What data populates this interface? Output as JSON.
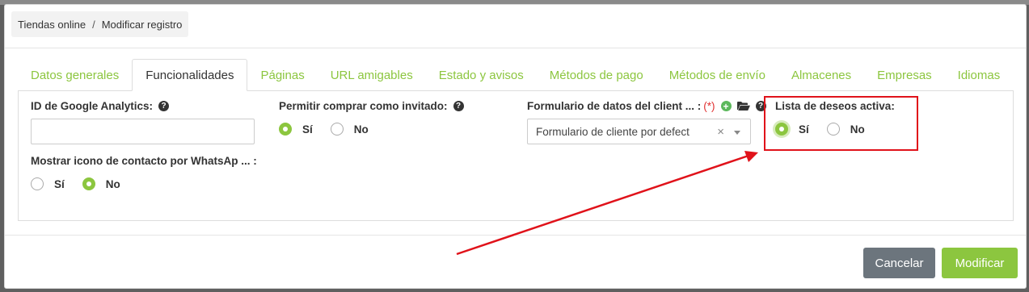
{
  "breadcrumb": {
    "root": "Tiendas online",
    "separator": "/",
    "current": "Modificar registro"
  },
  "tabs": [
    {
      "label": "Datos generales",
      "active": false
    },
    {
      "label": "Funcionalidades",
      "active": true
    },
    {
      "label": "Páginas",
      "active": false
    },
    {
      "label": "URL amigables",
      "active": false
    },
    {
      "label": "Estado y avisos",
      "active": false
    },
    {
      "label": "Métodos de pago",
      "active": false
    },
    {
      "label": "Métodos de envío",
      "active": false
    },
    {
      "label": "Almacenes",
      "active": false
    },
    {
      "label": "Empresas",
      "active": false
    },
    {
      "label": "Idiomas",
      "active": false
    }
  ],
  "fields": {
    "ga": {
      "label": "ID de Google Analytics:",
      "value": ""
    },
    "guest": {
      "label": "Permitir comprar como invitado:",
      "yes": "Sí",
      "no": "No",
      "selected": "yes"
    },
    "form": {
      "label": "Formulario de datos del client ... :",
      "required": "(*)",
      "value": "Formulario de cliente por defect",
      "clear": "×"
    },
    "wishlist": {
      "label": "Lista de deseos activa:",
      "yes": "Sí",
      "no": "No",
      "selected": "yes"
    },
    "whatsapp": {
      "label": "Mostrar icono de contacto por WhatsAp ... :",
      "yes": "Sí",
      "no": "No",
      "selected": "no"
    }
  },
  "buttons": {
    "cancel": "Cancelar",
    "submit": "Modificar"
  },
  "colors": {
    "accent": "#8cc63f",
    "annotation": "#e0121a",
    "cancel": "#6c757d"
  },
  "icons": {
    "help": "?",
    "plus": "+"
  }
}
